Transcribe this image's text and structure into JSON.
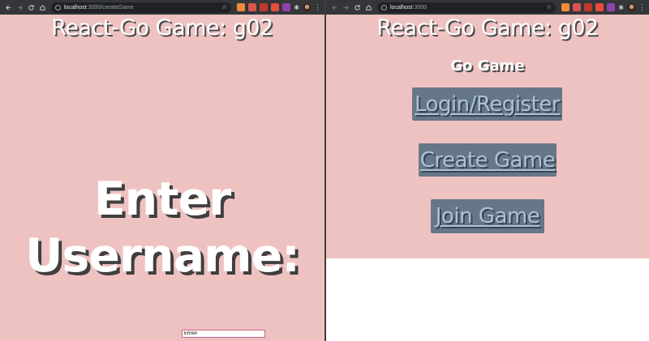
{
  "left_window": {
    "url": {
      "host": "localhost",
      "rest": ":3000/createGame"
    },
    "app_title": "React-Go Game: g02",
    "heading": {
      "line1": "Enter",
      "line2": "Username:"
    },
    "username_input": {
      "value": "Ehren"
    }
  },
  "right_window": {
    "url": {
      "host": "localhost",
      "rest": ":3000"
    },
    "app_title": "React-Go Game: g02",
    "subtitle": "Go Game",
    "buttons": {
      "login": "Login/Register",
      "create": "Create Game",
      "join": "Join Game"
    }
  },
  "colors": {
    "page_background": "#efc2c2",
    "button_background": "#667788",
    "button_text": "#a9c2d9",
    "browser_toolbar": "#35363a"
  },
  "icons": [
    "back-icon",
    "forward-icon",
    "reload-icon",
    "home-icon",
    "site-info-icon",
    "bookmark-star-icon",
    "extension-icons",
    "puzzle-icon",
    "profile-avatar",
    "menu-kebab-icon"
  ]
}
